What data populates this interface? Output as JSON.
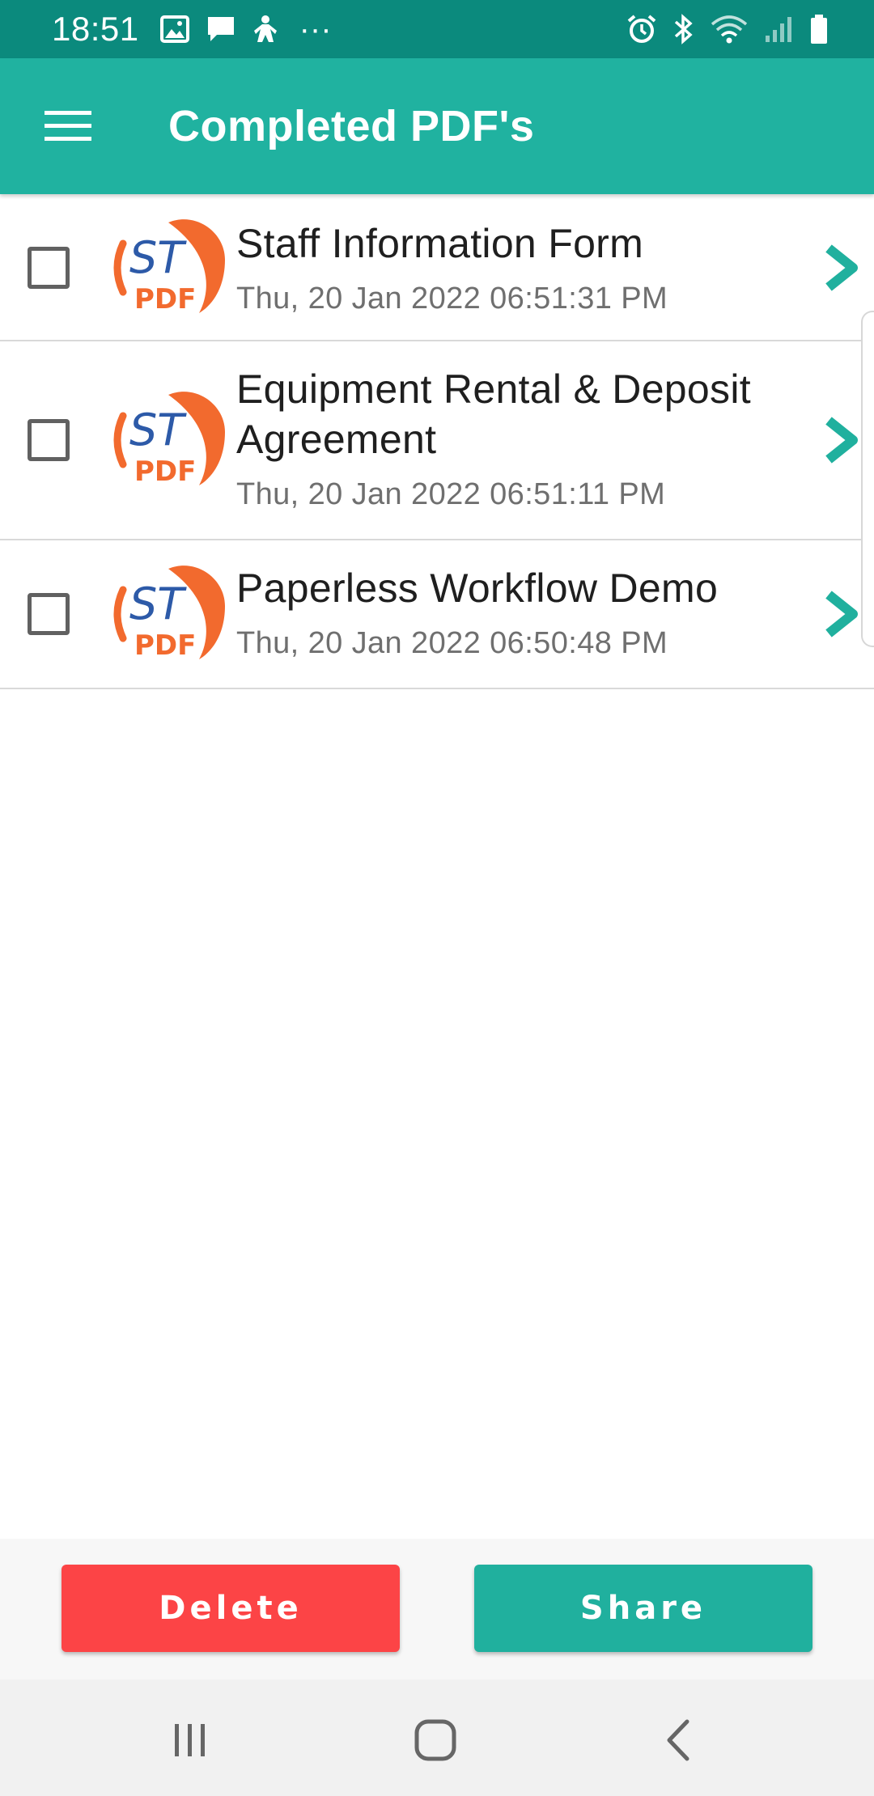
{
  "status_bar": {
    "time": "18:51",
    "more_indicator": "···",
    "left_icons": [
      "image-notification-icon",
      "message-notification-icon",
      "accessibility-notification-icon"
    ],
    "right_icons": [
      "alarm-icon",
      "bluetooth-icon",
      "wifi-icon",
      "signal-icon",
      "battery-icon"
    ]
  },
  "app_bar": {
    "title": "Completed PDF's",
    "menu_icon": "hamburger-menu-icon"
  },
  "logo": {
    "top_text": "ST",
    "bottom_text": "PDF"
  },
  "items": [
    {
      "title": "Staff Information Form",
      "date": "Thu, 20 Jan 2022 06:51:31 PM",
      "checked": false
    },
    {
      "title": "Equipment Rental & Deposit Agreement",
      "date": "Thu, 20 Jan 2022 06:51:11 PM",
      "checked": false
    },
    {
      "title": "Paperless Workflow Demo",
      "date": "Thu, 20 Jan 2022 06:50:48 PM",
      "checked": false
    }
  ],
  "actions": {
    "delete_label": "Delete",
    "share_label": "Share"
  },
  "nav_bar": {
    "recents_icon": "recent-apps-icon",
    "home_icon": "home-icon",
    "back_icon": "back-icon"
  },
  "colors": {
    "status_bar": "#0b8a7d",
    "app_bar": "#20b2a0",
    "accent": "#20b09e",
    "delete": "#fc4446",
    "logo_orange": "#f26a2e",
    "logo_blue": "#2d5aa8"
  }
}
